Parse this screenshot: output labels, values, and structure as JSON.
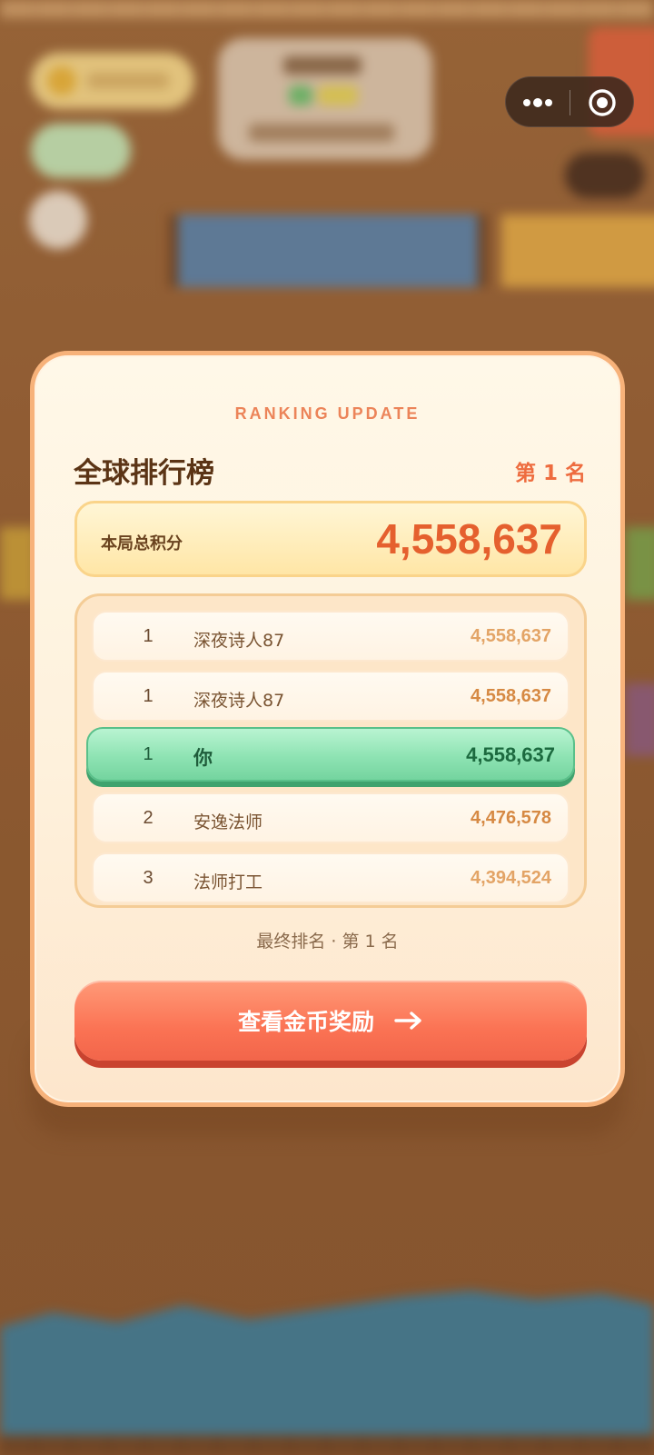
{
  "capsule": {
    "more_icon": "more-dots-icon",
    "close_icon": "target-circle-icon"
  },
  "modal": {
    "kicker": "RANKING UPDATE",
    "title": "全球排行榜",
    "rank_badge": "第 1 名",
    "total_label": "本局总积分",
    "total_value": "4,558,637",
    "leaderboard": [
      {
        "rank": "1",
        "name": "深夜诗人87",
        "score": "4,558,637",
        "is_me": false
      },
      {
        "rank": "1",
        "name": "深夜诗人87",
        "score": "4,558,637",
        "is_me": false
      },
      {
        "rank": "1",
        "name": "你",
        "score": "4,558,637",
        "is_me": true
      },
      {
        "rank": "2",
        "name": "安逸法师",
        "score": "4,476,578",
        "is_me": false
      },
      {
        "rank": "3",
        "name": "法师打工",
        "score": "4,394,524",
        "is_me": false
      }
    ],
    "final_rank": "最终排名 · 第 1 名",
    "cta_label": "查看金币奖励",
    "cta_icon": "arrow-right-icon"
  },
  "colors": {
    "accent_orange": "#e5602e",
    "highlight_green": "#8ee3b3",
    "cta_red": "#fb7354",
    "modal_border": "#f7b27a"
  }
}
